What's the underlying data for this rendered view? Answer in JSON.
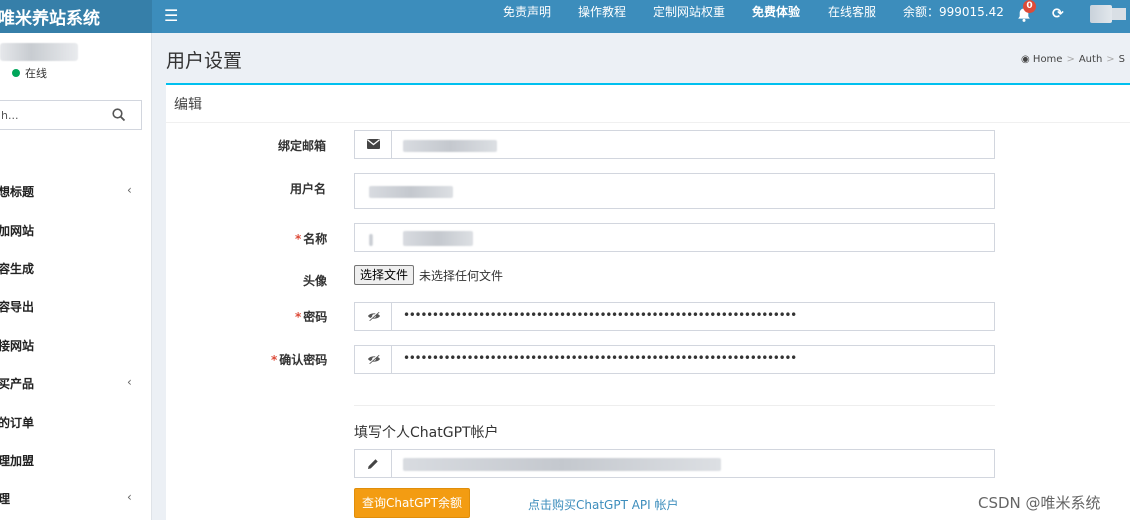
{
  "header": {
    "brand": "唯米养站系统",
    "nav": [
      "免责声明",
      "操作教程",
      "定制网站权重",
      "免费体验",
      "在线客服"
    ],
    "balance": "余额：999015.42",
    "notification_count": "0"
  },
  "sidebar": {
    "status": "在线",
    "search_placeholder": "h...",
    "items": [
      {
        "label": "想标题",
        "has_children": true
      },
      {
        "label": "加网站",
        "has_children": false
      },
      {
        "label": "容生成",
        "has_children": false
      },
      {
        "label": "容导出",
        "has_children": false
      },
      {
        "label": "接网站",
        "has_children": false
      },
      {
        "label": "买产品",
        "has_children": true
      },
      {
        "label": "的订单",
        "has_children": false
      },
      {
        "label": "理加盟",
        "has_children": false
      },
      {
        "label": "理",
        "has_children": true
      }
    ]
  },
  "page": {
    "title": "用户设置",
    "breadcrumb": [
      "Home",
      "Auth",
      "S"
    ]
  },
  "form": {
    "box_title": "编辑",
    "email_label": "绑定邮箱",
    "username_label": "用户名",
    "name_label": "名称",
    "avatar_label": "头像",
    "avatar_button": "选择文件",
    "avatar_status": "未选择任何文件",
    "password_label": "密码",
    "password_value": "••••••••••••••••••••••••••••••••••••••••••••••••••••••••••••••••••••",
    "confirm_label": "确认密码",
    "confirm_value": "••••••••••••••••••••••••••••••••••••••••••••••••••••••••••••••••••••",
    "chatgpt_title": "填写个人ChatGPT帐户",
    "query_button": "查询ChatGPT余额",
    "buy_link": "点击购买ChatGPT API 帐户"
  },
  "watermark": "CSDN @唯米系统",
  "colors": {
    "header": "#3c8dbc",
    "accent_top": "#00c0ef",
    "button": "#f39c12",
    "required": "#dd4b39",
    "online": "#00a65a"
  }
}
